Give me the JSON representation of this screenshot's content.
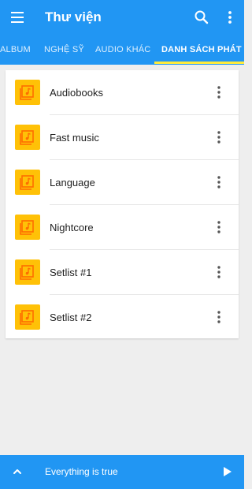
{
  "header": {
    "title": "Thư viện",
    "menu_icon": "hamburger-menu-icon",
    "search_icon": "search-icon",
    "more_icon": "more-vert-icon"
  },
  "tabs": [
    {
      "label": "ALBUM",
      "active": false
    },
    {
      "label": "NGHỆ SỸ",
      "active": false
    },
    {
      "label": "AUDIO KHÁC",
      "active": false
    },
    {
      "label": "DANH SÁCH PHÁT",
      "active": true
    }
  ],
  "playlists": [
    {
      "label": "Audiobooks"
    },
    {
      "label": "Fast music"
    },
    {
      "label": "Language"
    },
    {
      "label": "Nightcore"
    },
    {
      "label": "Setlist #1"
    },
    {
      "label": "Setlist #2"
    }
  ],
  "now_playing": {
    "track": "Everything is true",
    "expand_icon": "chevron-up-icon",
    "play_icon": "play-icon"
  },
  "colors": {
    "primary": "#2196f3",
    "accent_indicator": "#ffeb3b",
    "playlist_icon_bg": "#ffc107",
    "playlist_icon_fg": "#ff6d00",
    "background": "#eeeeee"
  }
}
